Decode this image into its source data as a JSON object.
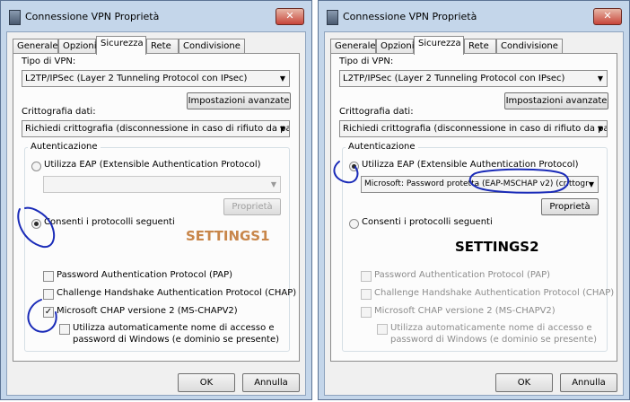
{
  "dialogs": [
    {
      "title": "Connessione VPN Proprietà",
      "close_glyph": "✕",
      "tabs": [
        "Generale",
        "Opzioni",
        "Sicurezza",
        "Rete",
        "Condivisione"
      ],
      "active_tab": "Sicurezza",
      "vpn_type_label": "Tipo di VPN:",
      "vpn_type_value": "L2TP/IPSec (Layer 2 Tunneling Protocol con IPsec)",
      "advanced_button": "Impostazioni avanzate",
      "encryption_label": "Crittografia dati:",
      "encryption_value": "Richiedi crittografia (disconnessione in caso di rifiuto da parte d",
      "auth_group": "Autenticazione",
      "eap_radio": "Utilizza EAP (Extensible Authentication Protocol)",
      "eap_select_value": "",
      "properties_button": "Proprietà",
      "protocols_radio": "Consenti i protocolli seguenti",
      "selected_radio": "protocols",
      "settings_tag": "SETTINGS1",
      "settings_color": "#c8864a",
      "checkboxes": [
        {
          "label": "Password Authentication Protocol (PAP)",
          "checked": false
        },
        {
          "label": "Challenge Handshake Authentication Protocol (CHAP)",
          "checked": false
        },
        {
          "label": "Microsoft CHAP versione 2 (MS-CHAPV2)",
          "checked": true
        }
      ],
      "auto_logon_label": "Utilizza automaticamente nome di accesso e",
      "auto_logon_label2": "password di Windows (e dominio se presente)",
      "ok_button": "OK",
      "cancel_button": "Annulla"
    },
    {
      "title": "Connessione VPN Proprietà",
      "close_glyph": "✕",
      "tabs": [
        "Generale",
        "Opzioni",
        "Sicurezza",
        "Rete",
        "Condivisione"
      ],
      "active_tab": "Sicurezza",
      "vpn_type_label": "Tipo di VPN:",
      "vpn_type_value": "L2TP/IPSec (Layer 2 Tunneling Protocol con IPsec)",
      "advanced_button": "Impostazioni avanzate",
      "encryption_label": "Crittografia dati:",
      "encryption_value": "Richiedi crittografia (disconnessione in caso di rifiuto da parte d",
      "auth_group": "Autenticazione",
      "eap_radio": "Utilizza EAP (Extensible Authentication Protocol)",
      "eap_select_value": "Microsoft: Password protetta (EAP-MSCHAP v2) (crittogr",
      "properties_button": "Proprietà",
      "protocols_radio": "Consenti i protocolli seguenti",
      "selected_radio": "eap",
      "settings_tag": "SETTINGS2",
      "settings_color": "#000000",
      "checkboxes": [
        {
          "label": "Password Authentication Protocol (PAP)",
          "checked": false
        },
        {
          "label": "Challenge Handshake Authentication Protocol (CHAP)",
          "checked": false
        },
        {
          "label": "Microsoft CHAP versione 2 (MS-CHAPV2)",
          "checked": false
        }
      ],
      "auto_logon_label": "Utilizza automaticamente nome di accesso e",
      "auto_logon_label2": "password di Windows (e dominio se presente)",
      "ok_button": "OK",
      "cancel_button": "Annulla"
    }
  ],
  "annotation_color": "#1a2bb8"
}
